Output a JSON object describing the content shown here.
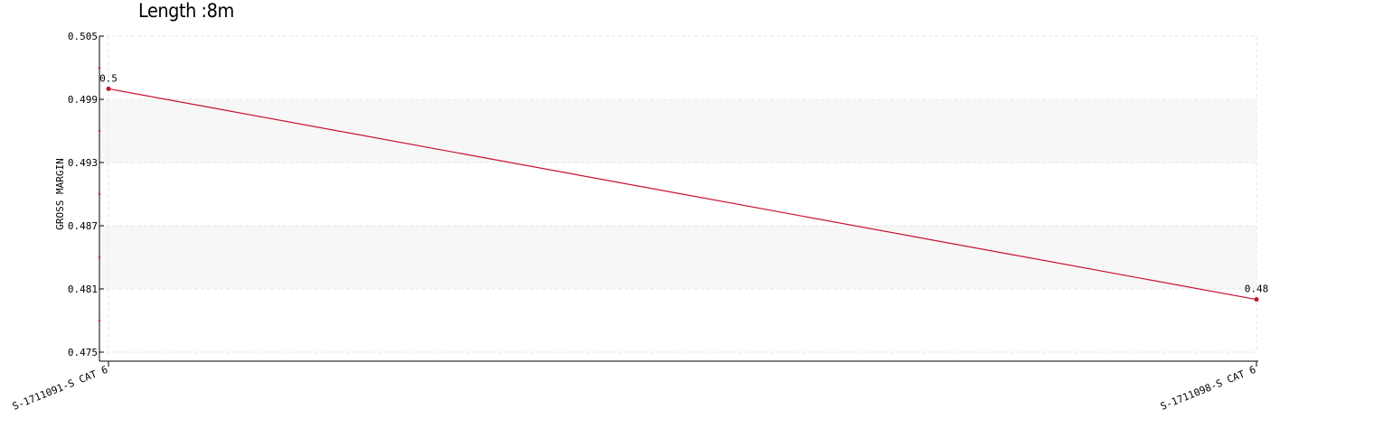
{
  "chart_data": {
    "type": "line",
    "title": "Length :8m",
    "xlabel": "",
    "ylabel": "GROSS MARGIN",
    "categories": [
      "S-1711091-S CAT 6",
      "S-1711098-S CAT 6"
    ],
    "series": [
      {
        "values": [
          0.5,
          0.48
        ],
        "data_labels": [
          "0.5",
          "0.48"
        ]
      }
    ],
    "ylim": [
      0.475,
      0.505
    ],
    "yticks": [
      0.475,
      0.481,
      0.487,
      0.493,
      0.499,
      0.505
    ],
    "ytick_labels": [
      "0.475",
      "0.481",
      "0.487",
      "0.493",
      "0.499",
      "0.505"
    ],
    "grid": true,
    "colors": {
      "line": "#c8102e",
      "band": "#f7f7f7",
      "grid": "#e6e6e6",
      "axis": "#000000",
      "minor_tick": "#c8102e"
    }
  }
}
